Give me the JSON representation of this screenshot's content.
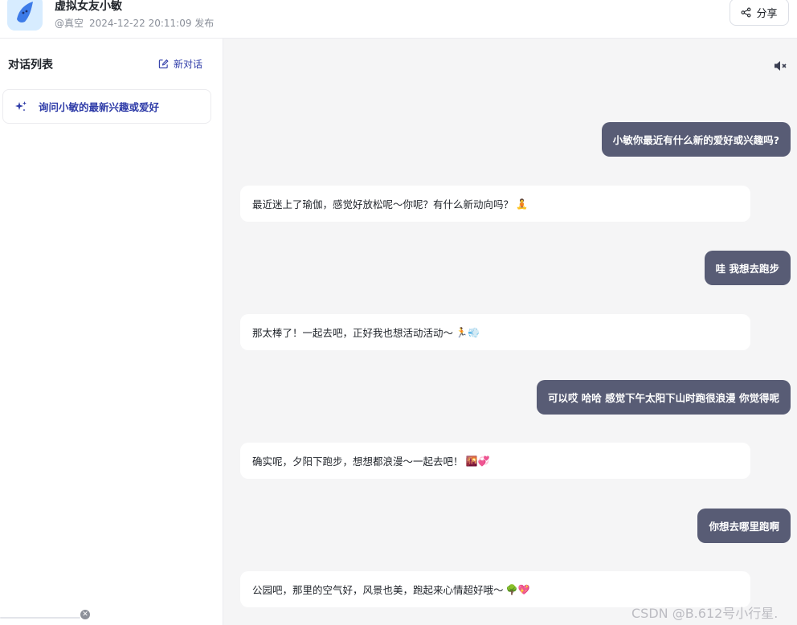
{
  "header": {
    "title": "虚拟女友小敏",
    "author": "@真空",
    "published": "2024-12-22 20:11:09 发布",
    "share_label": "分享"
  },
  "sidebar": {
    "title": "对话列表",
    "new_chat_label": "新对话",
    "conversations": [
      {
        "label": "询问小敏的最新兴趣或爱好"
      }
    ]
  },
  "messages": [
    {
      "role": "user",
      "text": "小敏你最近有什么新的爱好或兴趣吗?"
    },
    {
      "role": "bot",
      "text": "最近迷上了瑜伽，感觉好放松呢～你呢？有什么新动向吗？",
      "emoji": "🧘"
    },
    {
      "role": "user",
      "text": "哇  我想去跑步"
    },
    {
      "role": "bot",
      "text": "那太棒了！一起去吧，正好我也想活动活动～",
      "emoji": "🏃💨"
    },
    {
      "role": "user",
      "text": "可以哎  哈哈  感觉下午太阳下山时跑很浪漫  你觉得呢"
    },
    {
      "role": "bot",
      "text": "确实呢，夕阳下跑步，想想都浪漫～一起去吧！",
      "emoji": "🌇💞"
    },
    {
      "role": "user",
      "text": "你想去哪里跑啊"
    },
    {
      "role": "bot",
      "text": "公园吧，那里的空气好，风景也美，跑起来心情超好哦～",
      "emoji": "🌳💖"
    }
  ],
  "watermark": "CSDN @B.612号小行星.",
  "colors": {
    "accent": "#2f3ca8",
    "user_bubble": "#585c75",
    "background": "#f5f5f6"
  },
  "icons": [
    "bot-avatar-icon",
    "share-icon",
    "edit-icon",
    "sparkle-icon",
    "mute-icon",
    "close-icon"
  ]
}
